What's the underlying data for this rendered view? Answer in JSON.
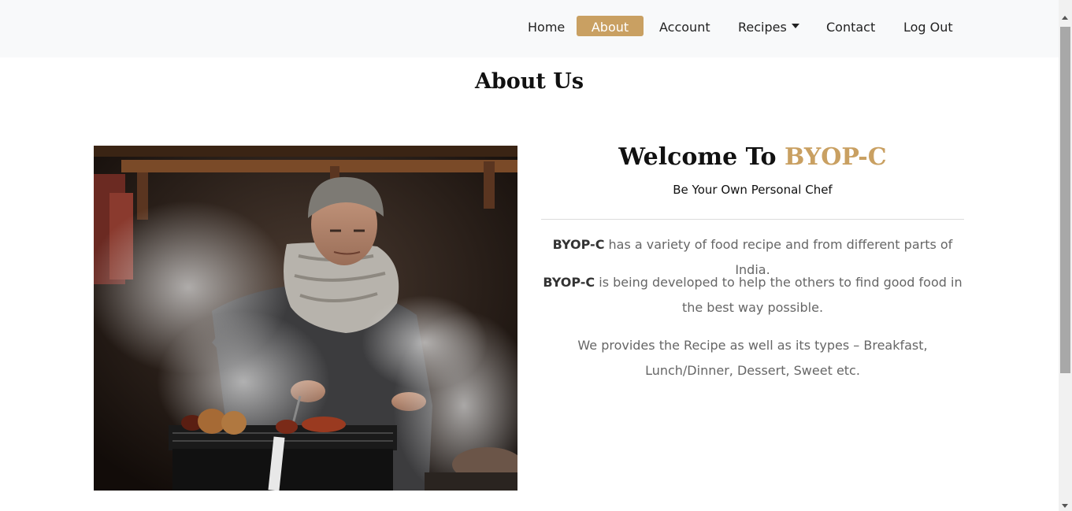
{
  "nav": {
    "items": [
      {
        "label": "Home"
      },
      {
        "label": "About"
      },
      {
        "label": "Account"
      },
      {
        "label": "Recipes"
      },
      {
        "label": "Contact"
      },
      {
        "label": "Log Out"
      }
    ],
    "active": "About"
  },
  "main": {
    "title": "About Us",
    "welcome_prefix": "Welcome To",
    "brand": "BYOP-C",
    "tagline": "Be Your Own Personal Chef",
    "paragraphs": [
      {
        "strong": "BYOP-C",
        "text": " has a variety of food recipe and from different parts of India."
      },
      {
        "strong": "BYOP-C",
        "text": " is being developed to help the others to find good food in the best way possible."
      },
      {
        "strong": "",
        "text": "We provides the Recipe as well as its types – Breakfast, Lunch/Dinner, Dessert, Sweet etc."
      }
    ]
  },
  "colors": {
    "accent": "#c9a062",
    "navbar_bg": "#f8f9fa",
    "text_muted": "#666666"
  },
  "icons": {
    "dropdown": "caret-down-icon"
  }
}
